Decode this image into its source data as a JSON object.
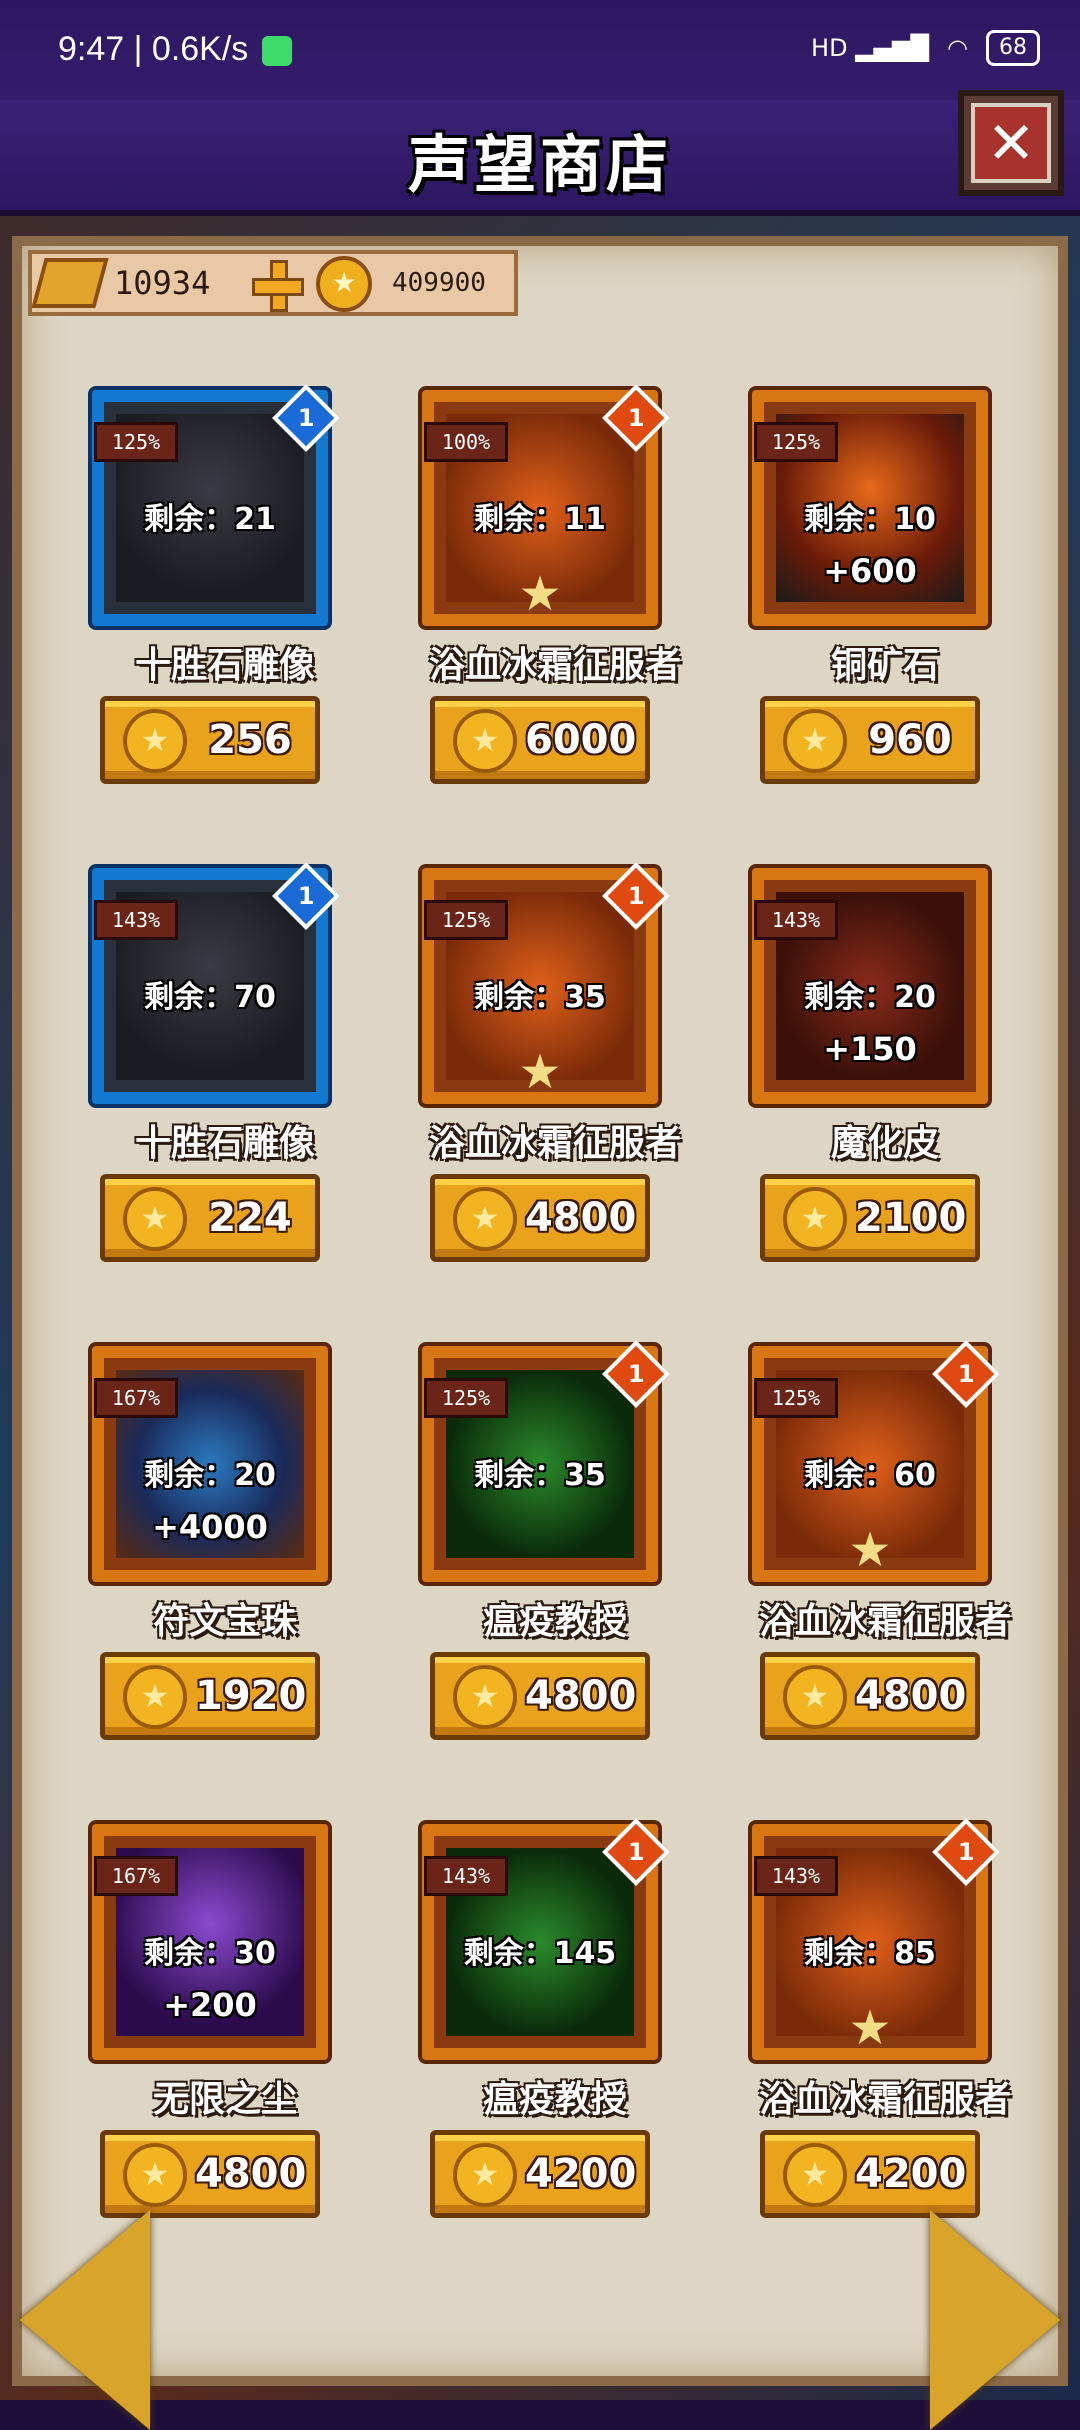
{
  "status": {
    "time": "9:47",
    "speed": "0.6K/s",
    "network": "HD",
    "battery": "68"
  },
  "header": {
    "title": "声望商店",
    "close_icon": "close-icon"
  },
  "currency": {
    "gold_bars": "10934",
    "coins": "409900"
  },
  "items": [
    {
      "name": "十胜石雕像",
      "pct": "125%",
      "remaining": "剩余：21",
      "bonus": "",
      "badge": "1",
      "price": "256",
      "frame": "blue",
      "art": "statue",
      "star": ""
    },
    {
      "name": "浴血冰霜征服者",
      "pct": "100%",
      "remaining": "剩余：11",
      "bonus": "",
      "badge": "1",
      "price": "6000",
      "frame": "orange",
      "art": "dragon",
      "star": "★"
    },
    {
      "name": "铜矿石",
      "pct": "125%",
      "remaining": "剩余：10",
      "bonus": "+600",
      "badge": "",
      "price": "960",
      "frame": "orange",
      "art": "ore",
      "star": ""
    },
    {
      "name": "十胜石雕像",
      "pct": "143%",
      "remaining": "剩余：70",
      "bonus": "",
      "badge": "1",
      "price": "224",
      "frame": "blue",
      "art": "statue",
      "star": ""
    },
    {
      "name": "浴血冰霜征服者",
      "pct": "125%",
      "remaining": "剩余：35",
      "bonus": "",
      "badge": "1",
      "price": "4800",
      "frame": "orange",
      "art": "dragon",
      "star": "★"
    },
    {
      "name": "魔化皮",
      "pct": "143%",
      "remaining": "剩余：20",
      "bonus": "+150",
      "badge": "",
      "price": "2100",
      "frame": "orange",
      "art": "leather",
      "star": ""
    },
    {
      "name": "符文宝珠",
      "pct": "167%",
      "remaining": "剩余：20",
      "bonus": "+4000",
      "badge": "",
      "price": "1920",
      "frame": "orange",
      "art": "orb",
      "star": ""
    },
    {
      "name": "瘟疫教授",
      "pct": "125%",
      "remaining": "剩余：35",
      "bonus": "",
      "badge": "1",
      "price": "4800",
      "frame": "orange",
      "art": "plague",
      "star": ""
    },
    {
      "name": "浴血冰霜征服者",
      "pct": "125%",
      "remaining": "剩余：60",
      "bonus": "",
      "badge": "1",
      "price": "4800",
      "frame": "orange",
      "art": "dragon",
      "star": "★"
    },
    {
      "name": "无限之尘",
      "pct": "167%",
      "remaining": "剩余：30",
      "bonus": "+200",
      "badge": "",
      "price": "4800",
      "frame": "orange",
      "art": "dust",
      "star": ""
    },
    {
      "name": "瘟疫教授",
      "pct": "143%",
      "remaining": "剩余：145",
      "bonus": "",
      "badge": "1",
      "price": "4200",
      "frame": "orange",
      "art": "plague",
      "star": ""
    },
    {
      "name": "浴血冰霜征服者",
      "pct": "143%",
      "remaining": "剩余：85",
      "bonus": "",
      "badge": "1",
      "price": "4200",
      "frame": "orange",
      "art": "dragon",
      "star": "★"
    }
  ],
  "colors": {
    "frame_blue": "#1278d0",
    "frame_orange": "#d97614",
    "price_button": "#e8a21c",
    "header_bg": "#3a2276"
  }
}
